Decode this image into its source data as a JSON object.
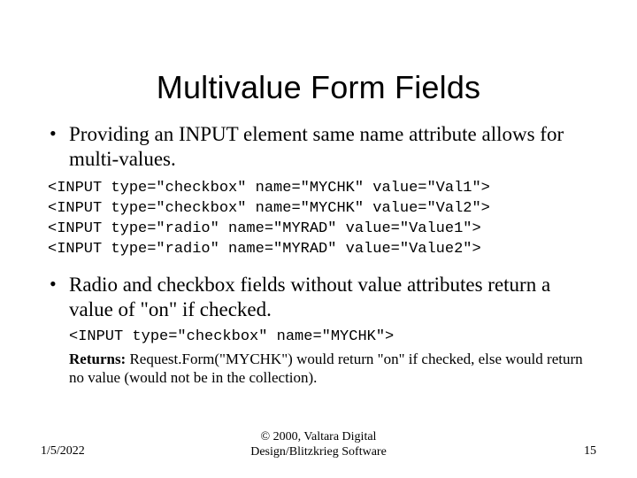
{
  "title": "Multivalue Form Fields",
  "bullets": {
    "first": "Providing an INPUT element same name attribute allows for multi-values.",
    "second": "Radio and checkbox fields without value attributes return a value of \"on\" if checked."
  },
  "code1": "<INPUT type=\"checkbox\" name=\"MYCHK\" value=\"Val1\">\n<INPUT type=\"checkbox\" name=\"MYCHK\" value=\"Val2\">\n<INPUT type=\"radio\" name=\"MYRAD\" value=\"Value1\">\n<INPUT type=\"radio\" name=\"MYRAD\" value=\"Value2\">",
  "code2": "<INPUT type=\"checkbox\" name=\"MYCHK\">",
  "returns_label": "Returns:",
  "returns_text": " Request.Form(\"MYCHK\") would return \"on\" if checked, else would return no value (would not be in the collection).",
  "footer": {
    "date": "1/5/2022",
    "center": "© 2000, Valtara Digital\nDesign/Blitzkrieg Software",
    "page": "15"
  }
}
